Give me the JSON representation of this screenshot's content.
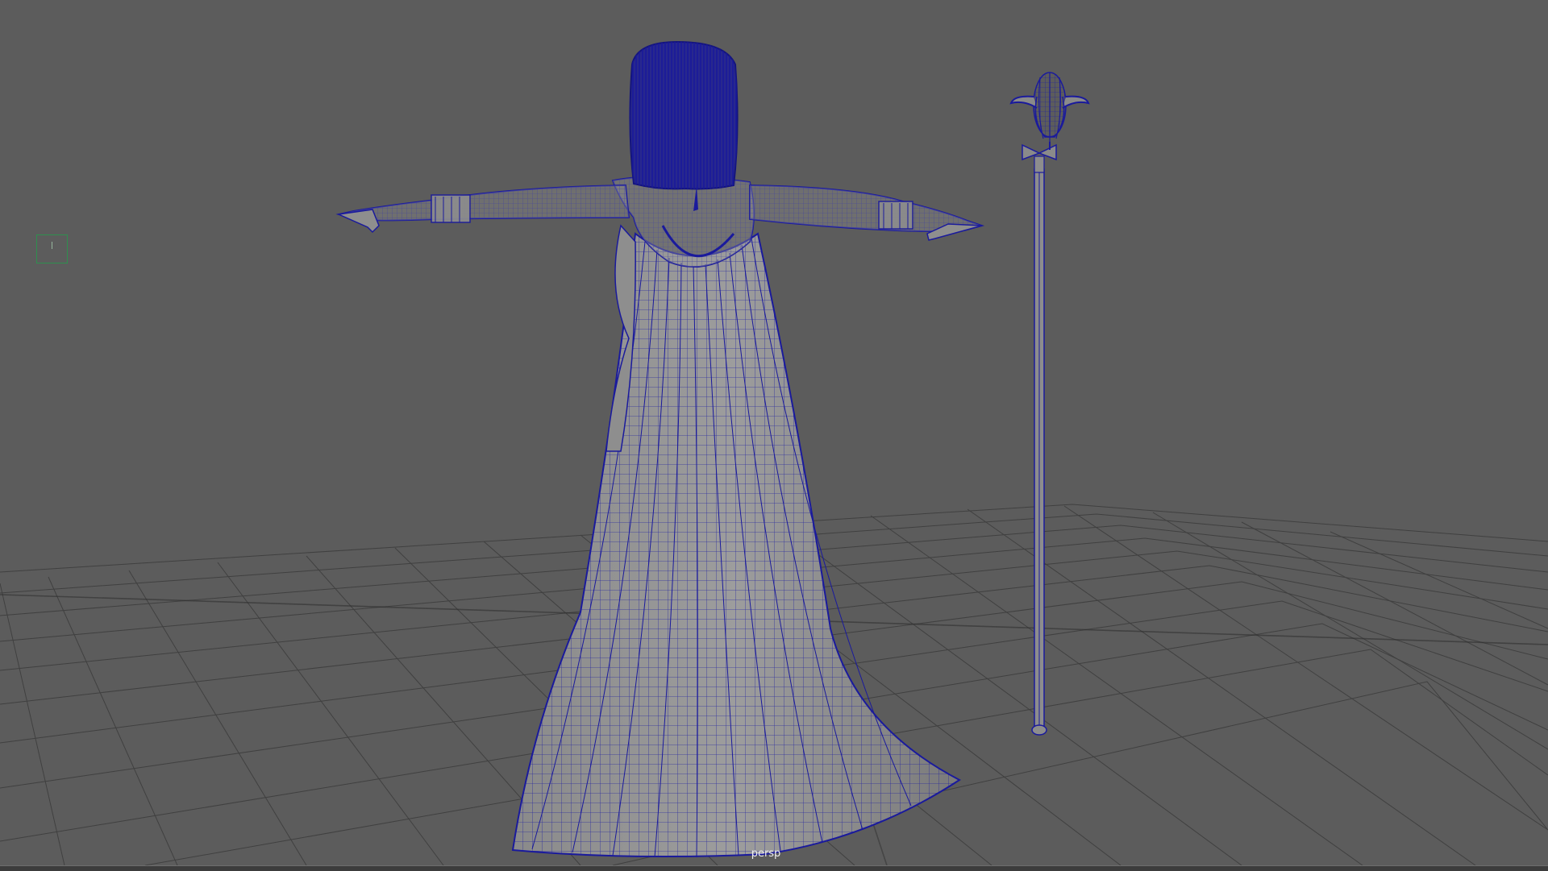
{
  "viewport": {
    "camera_name": "persp",
    "view_cube_glyph": "|"
  },
  "scene": {
    "objects": [
      "character-mesh-wireframe",
      "staff-mesh-wireframe",
      "ground-grid"
    ],
    "wireframe_color": "#1a1a9c",
    "grid_color": "#3a3a3a",
    "background_color": "#5c5c5c"
  },
  "icons": {
    "view_cube": "view-cube-icon"
  }
}
